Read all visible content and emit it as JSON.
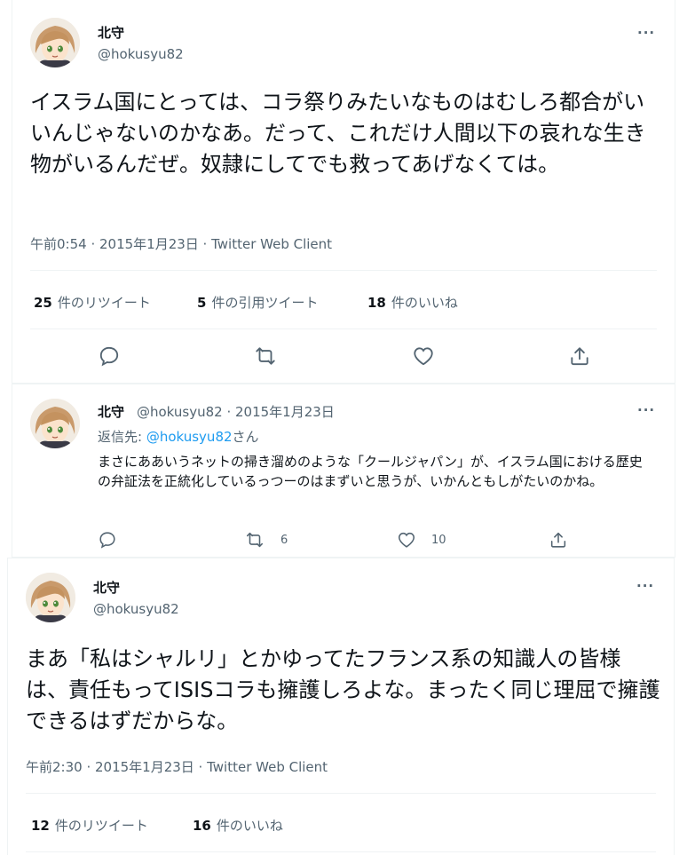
{
  "tweet1": {
    "display_name": "北守",
    "handle": "@hokusyu82",
    "more": "···",
    "text": "イスラム国にとっては、コラ祭りみたいなものはむしろ都合がいいんじゃないのかなあ。だって、これだけ人間以下の哀れな生き物がいるんだぜ。奴隷にしてでも救ってあげなくては。",
    "timestamp": "午前0:54 · 2015年1月23日 · Twitter Web Client",
    "retweets_count": "25",
    "retweets_label": "件のリツイート",
    "quotes_count": "5",
    "quotes_label": "件の引用ツイート",
    "likes_count": "18",
    "likes_label": "件のいいね"
  },
  "reply": {
    "display_name": "北守",
    "handle_date": "@hokusyu82 · 2015年1月23日",
    "more": "···",
    "reply_to_prefix": "返信先: ",
    "reply_to_handle": "@hokusyu82",
    "reply_to_suffix": "さん",
    "text": "まさにああいうネットの掃き溜めのような「クールジャパン」が、イスラム国における歴史の弁証法を正統化しているっつーのはまずいと思うが、いかんともしがたいのかね。",
    "retweet_count": "6",
    "like_count": "10"
  },
  "tweet2": {
    "display_name": "北守",
    "handle": "@hokusyu82",
    "more": "···",
    "text": "まあ「私はシャルリ」とかゆってたフランス系の知識人の皆様は、責任もってISISコラも擁護しろよな。まったく同じ理屈で擁護できるはずだからな。",
    "timestamp": "午前2:30 · 2015年1月23日 · Twitter Web Client",
    "retweets_count": "12",
    "retweets_label": "件のリツイート",
    "likes_count": "16",
    "likes_label": "件のいいね"
  },
  "icons": [
    "reply-icon",
    "retweet-icon",
    "like-icon",
    "share-icon",
    "more-icon"
  ],
  "colors": {
    "text": "#0f1419",
    "secondary": "#536471",
    "link": "#1d9bf0",
    "divider": "#eff3f4"
  }
}
